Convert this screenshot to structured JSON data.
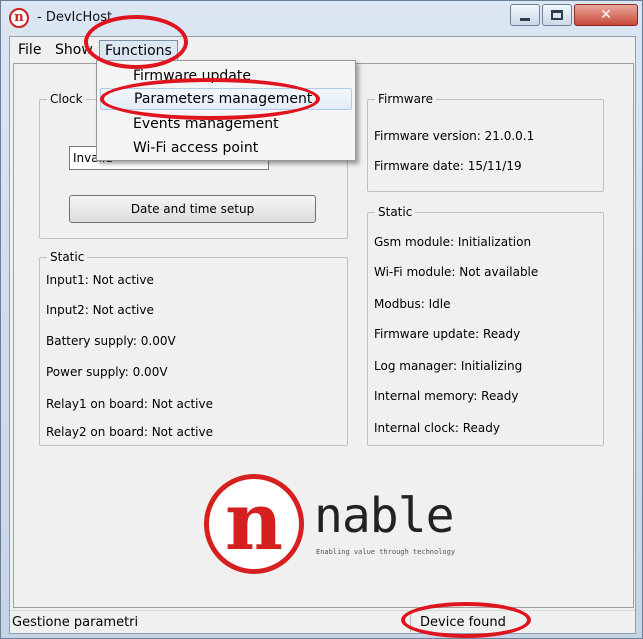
{
  "window": {
    "icon_glyph": "n",
    "title": "- DevIcHost"
  },
  "menu": {
    "file": "File",
    "show": "Show",
    "functions": "Functions"
  },
  "dropdown": {
    "items": [
      "Firmware update",
      "Parameters management",
      "Events management",
      "Wi-Fi access point"
    ]
  },
  "clock": {
    "title": "Clock",
    "input_value": "Invalid",
    "setup_button": "Date and time setup"
  },
  "firmware": {
    "title": "Firmware",
    "version": "Firmware version: 21.0.0.1",
    "date": "Firmware date: 15/11/19"
  },
  "static_left": {
    "title": "Static",
    "rows": [
      "Input1: Not active",
      "Input2: Not active",
      "Battery supply: 0.00V",
      "Power supply: 0.00V",
      "Relay1 on board: Not active",
      "Relay2 on board: Not active"
    ]
  },
  "static_right": {
    "title": "Static",
    "rows": [
      "Gsm module: Initialization",
      "Wi-Fi module: Not available",
      "Modbus: Idle",
      "Firmware update: Ready",
      "Log manager: Initializing",
      "Internal memory: Ready",
      "Internal clock: Ready"
    ]
  },
  "logo": {
    "mark": "n",
    "word": "nable",
    "tagline": "Enabling value through technology"
  },
  "status": {
    "left": "Gestione parametri",
    "right": "Device found"
  },
  "colors": {
    "brand_red": "#d61f1f",
    "annotation_red": "#e0141e",
    "menu_highlight": "#dde7f3"
  },
  "icons": {
    "app": "nable-logo-icon",
    "minimize": "minimize-icon",
    "maximize": "maximize-icon",
    "close": "close-icon"
  }
}
